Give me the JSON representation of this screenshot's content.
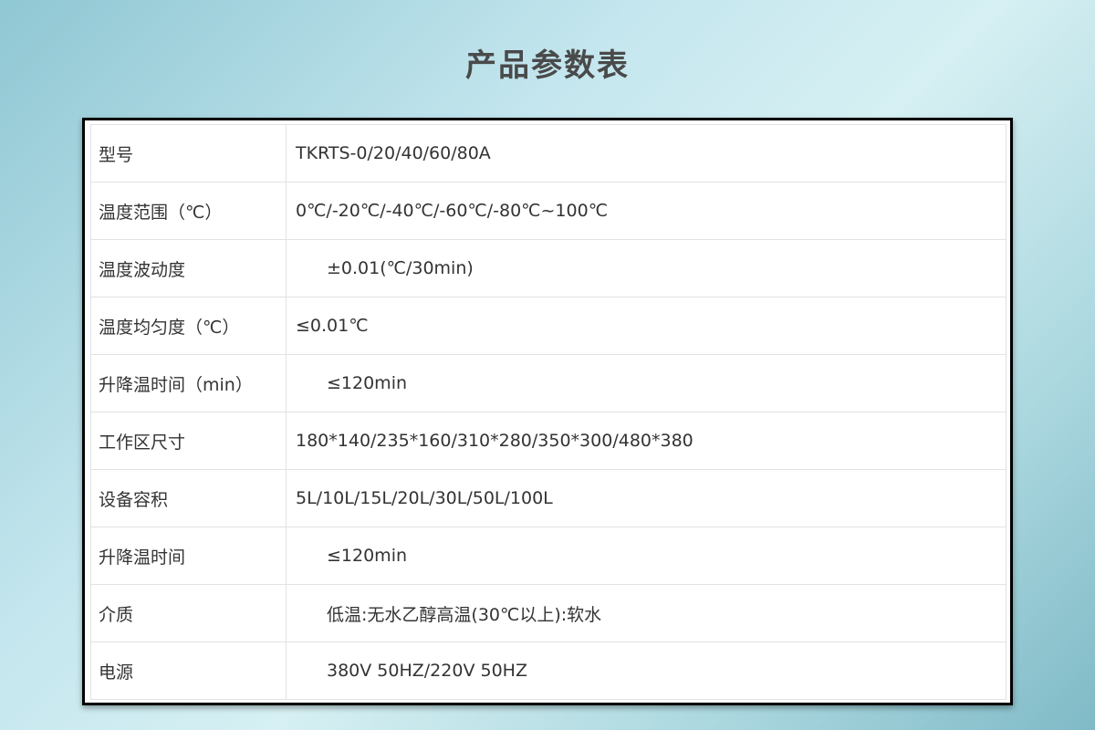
{
  "title": "产品参数表",
  "rows": [
    {
      "label": "型号",
      "value": "TKRTS-0/20/40/60/80A"
    },
    {
      "label": "温度范围（℃）",
      "value": "0℃/-20℃/-40℃/-60℃/-80℃~100℃"
    },
    {
      "label": "温度波动度",
      "value": "±0.01(℃/30min)"
    },
    {
      "label": "温度均匀度（℃）",
      "value": "≤0.01℃"
    },
    {
      "label": "升降温时间（min）",
      "value": "≤120min"
    },
    {
      "label": "工作区尺寸",
      "value": "180*140/235*160/310*280/350*300/480*380"
    },
    {
      "label": "设备容积",
      "value": "5L/10L/15L/20L/30L/50L/100L"
    },
    {
      "label": "升降温时间",
      "value": "≤120min"
    },
    {
      "label": "介质",
      "value": "低温:无水乙醇高温(30℃以上):软水"
    },
    {
      "label": "电源",
      "value": "380V 50HZ/220V 50HZ"
    }
  ]
}
